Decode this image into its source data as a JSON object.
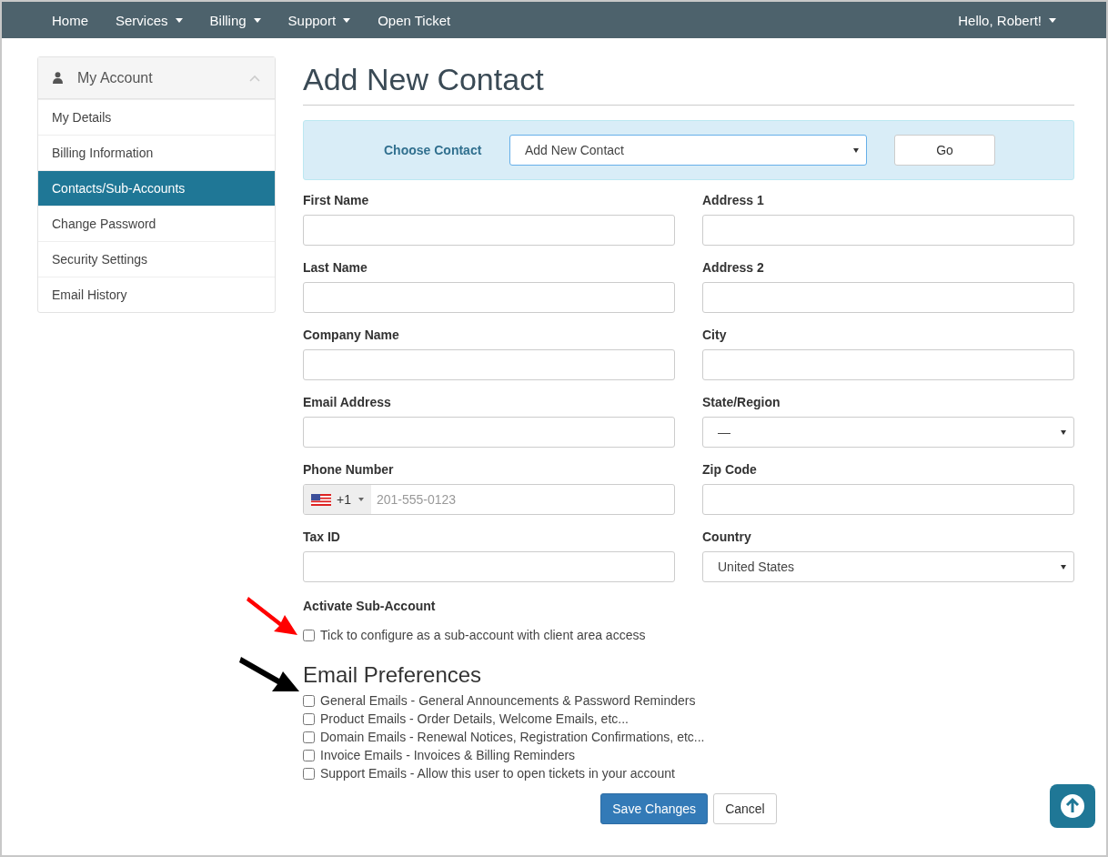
{
  "nav": {
    "items": [
      {
        "label": "Home",
        "dropdown": false
      },
      {
        "label": "Services",
        "dropdown": true
      },
      {
        "label": "Billing",
        "dropdown": true
      },
      {
        "label": "Support",
        "dropdown": true
      },
      {
        "label": "Open Ticket",
        "dropdown": false
      }
    ],
    "user": {
      "label": "Hello, Robert!",
      "dropdown": true
    }
  },
  "sidebar": {
    "title": "My Account",
    "expanded": true,
    "items": [
      {
        "label": "My Details",
        "selected": false
      },
      {
        "label": "Billing Information",
        "selected": false
      },
      {
        "label": "Contacts/Sub-Accounts",
        "selected": true
      },
      {
        "label": "Change Password",
        "selected": false
      },
      {
        "label": "Security Settings",
        "selected": false
      },
      {
        "label": "Email History",
        "selected": false
      }
    ]
  },
  "page_title": "Add New Contact",
  "choose_contact": {
    "label": "Choose Contact",
    "value": "Add New Contact",
    "button": "Go"
  },
  "fields": [
    {
      "label": "First Name",
      "kind": "text"
    },
    {
      "label": "Address 1",
      "kind": "text"
    },
    {
      "label": "Last Name",
      "kind": "text"
    },
    {
      "label": "Address 2",
      "kind": "text"
    },
    {
      "label": "Company Name",
      "kind": "text"
    },
    {
      "label": "City",
      "kind": "text"
    },
    {
      "label": "Email Address",
      "kind": "text"
    },
    {
      "label": "State/Region",
      "kind": "select",
      "value": "—"
    },
    {
      "label": "Phone Number",
      "kind": "phone",
      "code": "+1",
      "placeholder": "201-555-0123"
    },
    {
      "label": "Zip Code",
      "kind": "text"
    },
    {
      "label": "Tax ID",
      "kind": "text"
    },
    {
      "label": "Country",
      "kind": "select",
      "value": "United States"
    }
  ],
  "sub_account": {
    "heading": "Activate Sub-Account",
    "label": "Tick to configure as a sub-account with client area access",
    "checked": false
  },
  "email_preferences": {
    "title": "Email Preferences",
    "options": [
      {
        "label": "General Emails - General Announcements & Password Reminders",
        "checked": false
      },
      {
        "label": "Product Emails - Order Details, Welcome Emails, etc...",
        "checked": false
      },
      {
        "label": "Domain Emails - Renewal Notices, Registration Confirmations, etc...",
        "checked": false
      },
      {
        "label": "Invoice Emails - Invoices & Billing Reminders",
        "checked": false
      },
      {
        "label": "Support Emails - Allow this user to open tickets in your account",
        "checked": false
      }
    ]
  },
  "buttons": [
    {
      "label": "Save Changes",
      "kind": "primary"
    },
    {
      "label": "Cancel",
      "kind": "default"
    }
  ],
  "annotation_arrows": [
    {
      "color": "#ff0000"
    },
    {
      "color": "#000000"
    }
  ]
}
